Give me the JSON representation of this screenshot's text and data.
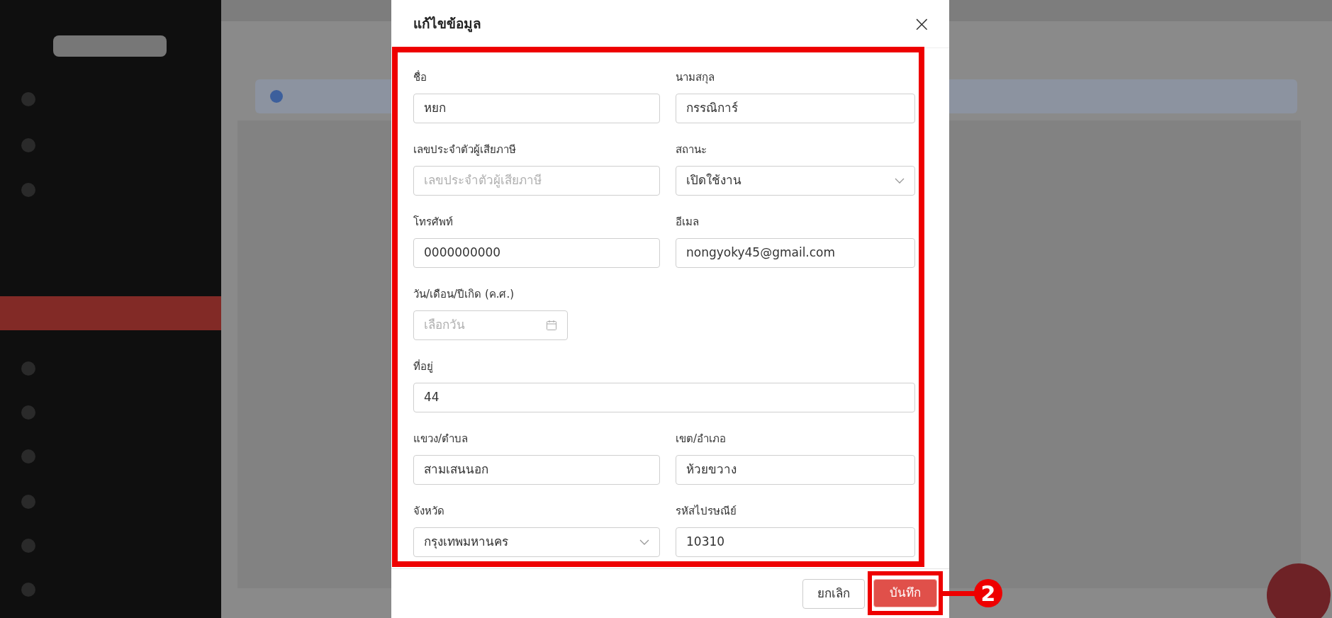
{
  "modal": {
    "title": "แก้ไขข้อมูล",
    "close_icon": "×"
  },
  "fields": [
    {
      "kind": "text",
      "label": "ชื่อ",
      "value": "หยก"
    },
    {
      "kind": "text",
      "label": "นามสกุล",
      "value": "กรรณิการ์"
    },
    {
      "kind": "text",
      "label": "เลขประจำตัวผู้เสียภาษี",
      "placeholder": "เลขประจำตัวผู้เสียภาษี"
    },
    {
      "kind": "select",
      "label": "สถานะ",
      "value": "เปิดใช้งาน"
    },
    {
      "kind": "text",
      "label": "โทรศัพท์",
      "value": "0000000000"
    },
    {
      "kind": "text",
      "label": "อีเมล",
      "value": "nongyoky45@gmail.com"
    },
    {
      "kind": "date",
      "label": "วัน/เดือน/ปีเกิด (ค.ศ.)",
      "placeholder": "เลือกวัน"
    },
    {
      "kind": "wide",
      "label": "ที่อยู่",
      "value": "44"
    },
    {
      "kind": "text",
      "label": "แขวง/ตำบล",
      "value": "สามเสนนอก"
    },
    {
      "kind": "text",
      "label": "เขต/อำเภอ",
      "value": "ห้วยขวาง"
    },
    {
      "kind": "select",
      "label": "จังหวัด",
      "value": "กรุงเทพมหานคร"
    },
    {
      "kind": "text",
      "label": "รหัสไปรษณีย์",
      "value": "10310"
    }
  ],
  "buttons": [
    {
      "kind": "cancel",
      "label": "ยกเลิก"
    },
    {
      "kind": "primary",
      "label": "บันทึก"
    }
  ],
  "callout": {
    "number": "2"
  }
}
